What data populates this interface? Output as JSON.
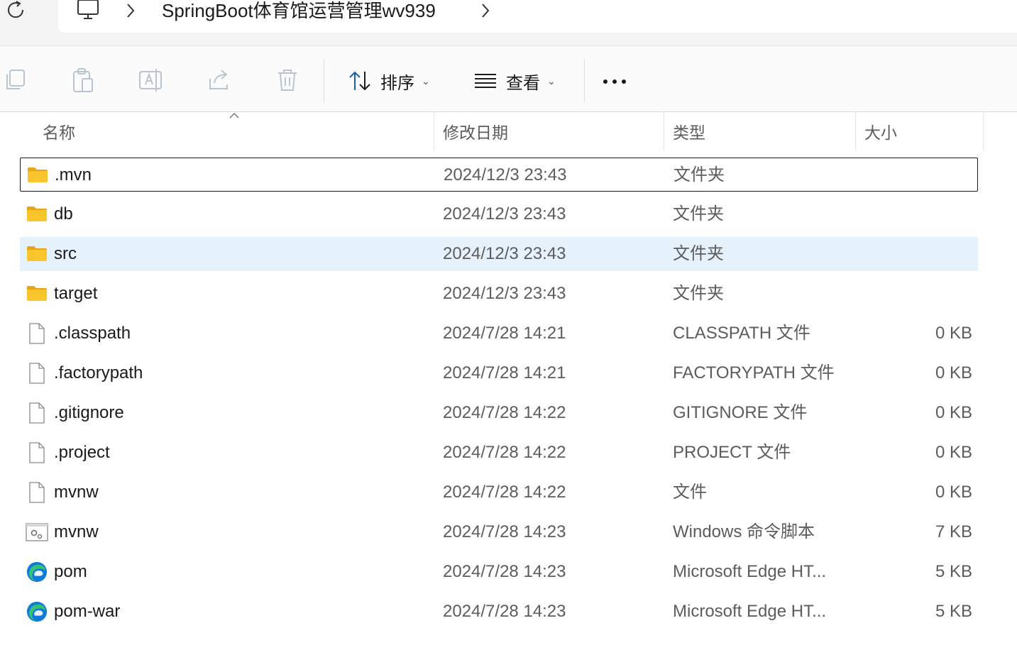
{
  "address_bar": {
    "path_root_icon": "pc-icon",
    "folder_name": "SpringBoot体育馆运营管理wv939"
  },
  "toolbar": {
    "copy_icon": "copy-icon",
    "paste_icon": "paste-icon",
    "rename_icon": "rename-icon",
    "share_icon": "share-icon",
    "delete_icon": "delete-icon",
    "sort_label": "排序",
    "view_label": "查看",
    "more_icon": "more-icon"
  },
  "columns": {
    "name": "名称",
    "modified": "修改日期",
    "type": "类型",
    "size": "大小"
  },
  "files": [
    {
      "name": ".mvn",
      "date": "2024/12/3 23:43",
      "type": "文件夹",
      "size": "",
      "icon": "folder-icon",
      "state": "selected"
    },
    {
      "name": "db",
      "date": "2024/12/3 23:43",
      "type": "文件夹",
      "size": "",
      "icon": "folder-icon",
      "state": ""
    },
    {
      "name": "src",
      "date": "2024/12/3 23:43",
      "type": "文件夹",
      "size": "",
      "icon": "folder-icon",
      "state": "hover"
    },
    {
      "name": "target",
      "date": "2024/12/3 23:43",
      "type": "文件夹",
      "size": "",
      "icon": "folder-icon",
      "state": ""
    },
    {
      "name": ".classpath",
      "date": "2024/7/28 14:21",
      "type": "CLASSPATH 文件",
      "size": "0 KB",
      "icon": "file-icon",
      "state": ""
    },
    {
      "name": ".factorypath",
      "date": "2024/7/28 14:21",
      "type": "FACTORYPATH 文件",
      "size": "0 KB",
      "icon": "file-icon",
      "state": ""
    },
    {
      "name": ".gitignore",
      "date": "2024/7/28 14:22",
      "type": "GITIGNORE 文件",
      "size": "0 KB",
      "icon": "file-icon",
      "state": ""
    },
    {
      "name": ".project",
      "date": "2024/7/28 14:22",
      "type": "PROJECT 文件",
      "size": "0 KB",
      "icon": "file-icon",
      "state": ""
    },
    {
      "name": "mvnw",
      "date": "2024/7/28 14:22",
      "type": "文件",
      "size": "0 KB",
      "icon": "file-icon",
      "state": ""
    },
    {
      "name": "mvnw",
      "date": "2024/7/28 14:23",
      "type": "Windows 命令脚本",
      "size": "7 KB",
      "icon": "script-icon",
      "state": ""
    },
    {
      "name": "pom",
      "date": "2024/7/28 14:23",
      "type": "Microsoft Edge HT...",
      "size": "5 KB",
      "icon": "edge-icon",
      "state": ""
    },
    {
      "name": "pom-war",
      "date": "2024/7/28 14:23",
      "type": "Microsoft Edge HT...",
      "size": "5 KB",
      "icon": "edge-icon",
      "state": ""
    }
  ],
  "colors": {
    "hover_row": "#e5f1fb",
    "folder": "#f8c52c",
    "secondary_text": "#5c5c5c"
  }
}
